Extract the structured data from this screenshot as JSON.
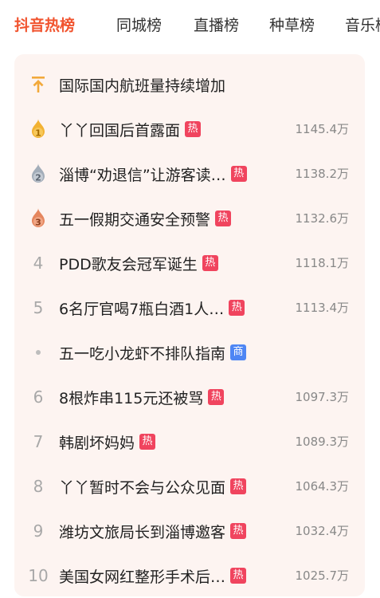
{
  "tabs": [
    {
      "label": "抖音热榜",
      "active": true
    },
    {
      "label": "同城榜",
      "active": false
    },
    {
      "label": "直播榜",
      "active": false
    },
    {
      "label": "种草榜",
      "active": false
    },
    {
      "label": "音乐榜",
      "active": false
    }
  ],
  "colors": {
    "accent": "#f1542f",
    "hot_badge": "#f0445e",
    "biz_badge": "#4e86f4",
    "gold": "#f2b233",
    "silver": "#a3adb9",
    "bronze": "#e5865e"
  },
  "list": [
    {
      "rank": "",
      "rank_icon": "pin-top-icon",
      "title": "国际国内航班量持续增加",
      "badge": "",
      "count": ""
    },
    {
      "rank": "1",
      "rank_icon": "gold-medal-icon",
      "title": "丫丫回国后首露面",
      "badge": "热",
      "count": "1145.4万"
    },
    {
      "rank": "2",
      "rank_icon": "silver-medal-icon",
      "title": "淄博“劝退信”让游客读…",
      "badge": "热",
      "count": "1138.2万"
    },
    {
      "rank": "3",
      "rank_icon": "bronze-medal-icon",
      "title": "五一假期交通安全预警",
      "badge": "热",
      "count": "1132.6万"
    },
    {
      "rank": "4",
      "rank_icon": "",
      "title": "PDD歌友会冠军诞生",
      "badge": "热",
      "count": "1118.1万"
    },
    {
      "rank": "5",
      "rank_icon": "",
      "title": "6名厅官喝7瓶白酒1人…",
      "badge": "热",
      "count": "1113.4万"
    },
    {
      "rank": "",
      "rank_icon": "dot-icon",
      "title": "五一吃小龙虾不排队指南",
      "badge": "商",
      "count": ""
    },
    {
      "rank": "6",
      "rank_icon": "",
      "title": "8根炸串115元还被骂",
      "badge": "热",
      "count": "1097.3万"
    },
    {
      "rank": "7",
      "rank_icon": "",
      "title": "韩剧坏妈妈",
      "badge": "热",
      "count": "1089.3万"
    },
    {
      "rank": "8",
      "rank_icon": "",
      "title": "丫丫暂时不会与公众见面",
      "badge": "热",
      "count": "1064.3万"
    },
    {
      "rank": "9",
      "rank_icon": "",
      "title": "潍坊文旅局长到淄博邀客",
      "badge": "热",
      "count": "1032.4万"
    },
    {
      "rank": "10",
      "rank_icon": "",
      "title": "美国女网红整形手术后…",
      "badge": "热",
      "count": "1025.7万"
    }
  ]
}
